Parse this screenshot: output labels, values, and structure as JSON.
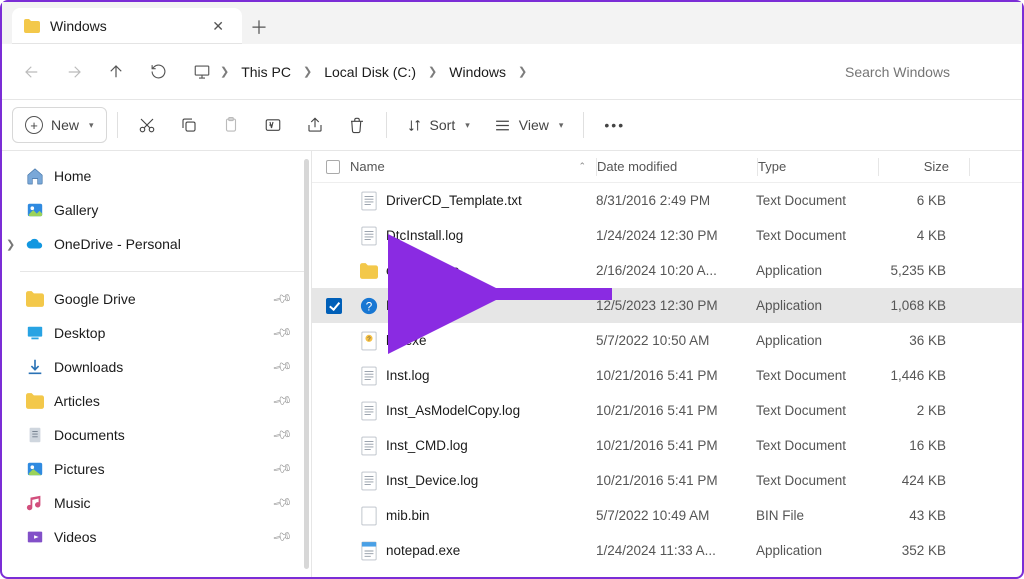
{
  "tab": {
    "title": "Windows"
  },
  "breadcrumb": {
    "pc": "This PC",
    "drive": "Local Disk (C:)",
    "folder": "Windows"
  },
  "search": {
    "placeholder": "Search Windows"
  },
  "toolbar": {
    "new": "New",
    "sort": "Sort",
    "view": "View"
  },
  "sidebar": {
    "home": "Home",
    "gallery": "Gallery",
    "onedrive": "OneDrive - Personal",
    "pinned": [
      {
        "key": "gdrive",
        "label": "Google Drive"
      },
      {
        "key": "desktop",
        "label": "Desktop"
      },
      {
        "key": "downloads",
        "label": "Downloads"
      },
      {
        "key": "articles",
        "label": "Articles"
      },
      {
        "key": "documents",
        "label": "Documents"
      },
      {
        "key": "pictures",
        "label": "Pictures"
      },
      {
        "key": "music",
        "label": "Music"
      },
      {
        "key": "videos",
        "label": "Videos"
      }
    ]
  },
  "columns": {
    "name": "Name",
    "date": "Date modified",
    "type": "Type",
    "size": "Size"
  },
  "files": [
    {
      "icon": "txt",
      "name": "DriverCD_Template.txt",
      "date": "8/31/2016 2:49 PM",
      "type": "Text Document",
      "size": "6 KB",
      "selected": false
    },
    {
      "icon": "txt",
      "name": "DtcInstall.log",
      "date": "1/24/2024 12:30 PM",
      "type": "Text Document",
      "size": "4 KB",
      "selected": false
    },
    {
      "icon": "folder",
      "name": "explorer.exe",
      "date": "2/16/2024 10:20 A...",
      "type": "Application",
      "size": "5,235 KB",
      "selected": false
    },
    {
      "icon": "help",
      "name": "HelpPane.exe",
      "date": "12/5/2023 12:30 PM",
      "type": "Application",
      "size": "1,068 KB",
      "selected": true,
      "highlight": true
    },
    {
      "icon": "chm",
      "name": "hh.exe",
      "date": "5/7/2022 10:50 AM",
      "type": "Application",
      "size": "36 KB",
      "selected": false
    },
    {
      "icon": "txt",
      "name": "Inst.log",
      "date": "10/21/2016 5:41 PM",
      "type": "Text Document",
      "size": "1,446 KB",
      "selected": false
    },
    {
      "icon": "txt",
      "name": "Inst_AsModelCopy.log",
      "date": "10/21/2016 5:41 PM",
      "type": "Text Document",
      "size": "2 KB",
      "selected": false
    },
    {
      "icon": "txt",
      "name": "Inst_CMD.log",
      "date": "10/21/2016 5:41 PM",
      "type": "Text Document",
      "size": "16 KB",
      "selected": false
    },
    {
      "icon": "txt",
      "name": "Inst_Device.log",
      "date": "10/21/2016 5:41 PM",
      "type": "Text Document",
      "size": "424 KB",
      "selected": false
    },
    {
      "icon": "blank",
      "name": "mib.bin",
      "date": "5/7/2022 10:49 AM",
      "type": "BIN File",
      "size": "43 KB",
      "selected": false
    },
    {
      "icon": "notepad",
      "name": "notepad.exe",
      "date": "1/24/2024 11:33 A...",
      "type": "Application",
      "size": "352 KB",
      "selected": false
    }
  ]
}
